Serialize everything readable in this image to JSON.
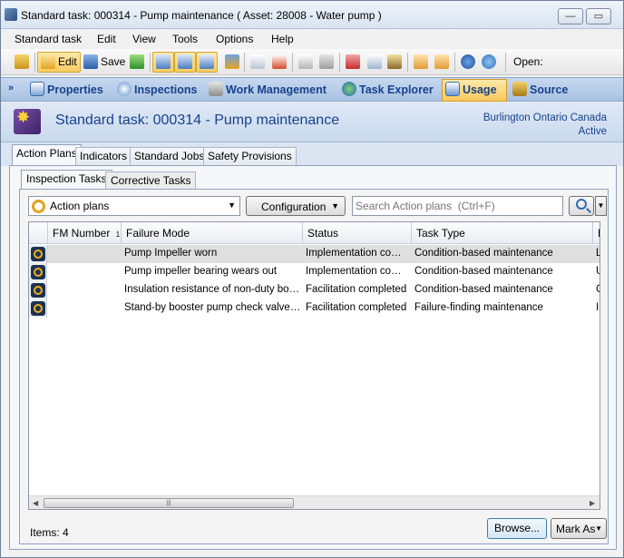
{
  "window": {
    "title": "Standard task: 000314 - Pump maintenance    ( Asset: 28008 - Water pump )",
    "minimize": "—",
    "maximize": "▭",
    "close": "✕"
  },
  "menu": [
    "Standard task",
    "Edit",
    "View",
    "Tools",
    "Options",
    "Help"
  ],
  "toolbar": {
    "edit_label": "Edit",
    "save_label": "Save",
    "open_label": "Open:"
  },
  "nav": [
    "Properties",
    "Inspections",
    "Work Management",
    "Task Explorer",
    "Usage",
    "Source"
  ],
  "header": {
    "title": "Standard task: 000314 - Pump maintenance",
    "location": "Burlington Ontario Canada",
    "state": "Active"
  },
  "tabs": [
    "Action Plans",
    "Indicators",
    "Standard Jobs",
    "Safety Provisions"
  ],
  "subtabs": [
    "Inspection Tasks",
    "Corrective Tasks"
  ],
  "controls": {
    "view_select": "Action plans",
    "configuration_label": "Configuration",
    "search_placeholder": "Search Action plans  (Ctrl+F)"
  },
  "grid": {
    "columns": [
      "FM Number",
      "Failure Mode",
      "Status",
      "Task Type",
      "Re"
    ],
    "sort_indicator": "1",
    "rows": [
      {
        "fm_number": "",
        "failure_mode": "Pump Impeller worn",
        "status": "Implementation completed",
        "task_type": "Condition-based maintenance",
        "re": "Log"
      },
      {
        "fm_number": "",
        "failure_mode": "Pump impeller bearing wears out",
        "status": "Implementation completed",
        "task_type": "Condition-based maintenance",
        "re": "Use"
      },
      {
        "fm_number": "",
        "failure_mode": "Insulation resistance of non-duty booster",
        "status": "Facilitation completed",
        "task_type": "Condition-based maintenance",
        "re": "Ch"
      },
      {
        "fm_number": "",
        "failure_mode": "Stand-by booster pump check valve jammed",
        "status": "Facilitation completed",
        "task_type": "Failure-finding maintenance",
        "re": "Ins"
      }
    ],
    "selected_row": 0
  },
  "footer": {
    "items_count": "Items: 4",
    "browse_label": "Browse...",
    "mark_as_label": "Mark As"
  }
}
